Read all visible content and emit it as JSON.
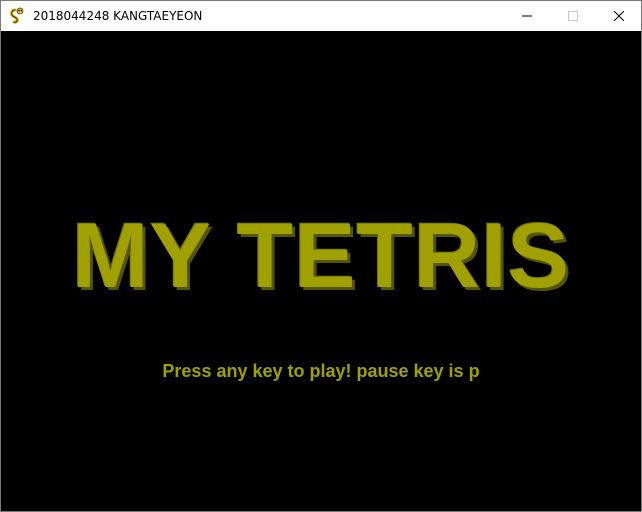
{
  "window": {
    "title": "2018044248 KANGTAEYEON",
    "icon": "pygame-snake-icon",
    "controls": {
      "minimize": "minimize-icon",
      "maximize": "maximize-icon",
      "close": "close-icon"
    }
  },
  "game": {
    "title": "MY TETRIS",
    "subtitle": "Press any key to play! pause key is p",
    "colors": {
      "background": "#000000",
      "title_text": "#a0a000",
      "subtitle_text": "#a0a000"
    }
  }
}
